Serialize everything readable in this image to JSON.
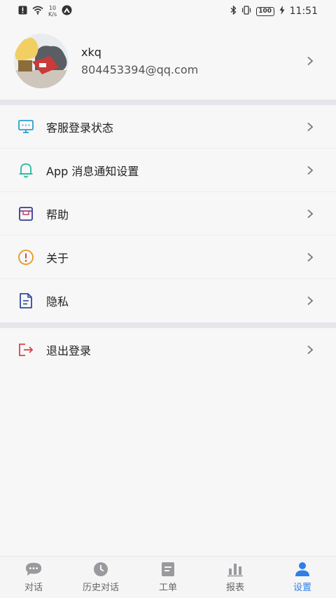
{
  "status_bar": {
    "net_speed_value": "10",
    "net_speed_unit": "K/s",
    "battery": "100",
    "time": "11:51"
  },
  "profile": {
    "name": "xkq",
    "email": "804453394@qq.com"
  },
  "menu_group_1": [
    {
      "label": "客服登录状态",
      "icon": "monitor-icon",
      "color": "#2c9fd0"
    },
    {
      "label": "App 消息通知设置",
      "icon": "bell-icon",
      "color": "#27b8a0"
    },
    {
      "label": "帮助",
      "icon": "help-box-icon",
      "color": "#3b3a8f"
    },
    {
      "label": "关于",
      "icon": "info-icon",
      "color": "#e89a1f"
    },
    {
      "label": "隐私",
      "icon": "document-icon",
      "color": "#2c4c9c"
    }
  ],
  "menu_group_2": [
    {
      "label": "退出登录",
      "icon": "logout-icon",
      "color": "#d64545"
    }
  ],
  "tabs": [
    {
      "label": "对话",
      "icon": "chat-bubble-icon",
      "active": false
    },
    {
      "label": "历史对话",
      "icon": "clock-icon",
      "active": false
    },
    {
      "label": "工单",
      "icon": "ticket-icon",
      "active": false
    },
    {
      "label": "报表",
      "icon": "bar-chart-icon",
      "active": false
    },
    {
      "label": "设置",
      "icon": "person-icon",
      "active": true
    }
  ],
  "colors": {
    "accent": "#2f7fe6",
    "inactive_icon": "#9a9a9e",
    "divider_band": "#e4e6ea",
    "background": "#f7f7f8"
  }
}
